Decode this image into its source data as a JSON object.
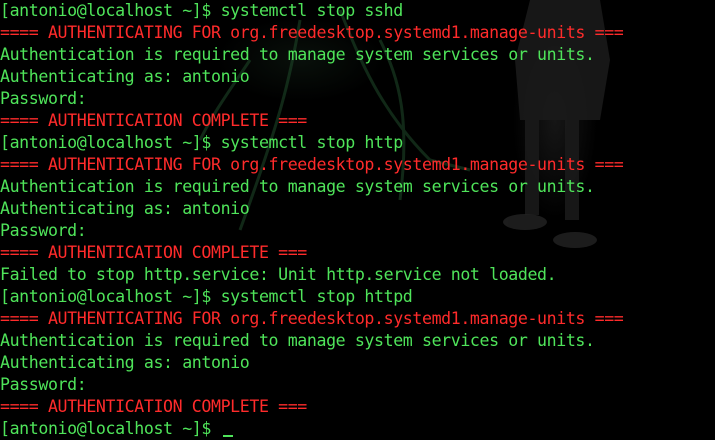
{
  "colors": {
    "background": "#000000",
    "prompt": "#4fe45a",
    "output": "#4fe45a",
    "auth_banner": "#ff2b2b"
  },
  "terminal": {
    "lines": [
      {
        "kind": "prompt",
        "text": "[antonio@localhost ~]$ systemctl stop sshd"
      },
      {
        "kind": "auth",
        "text": "==== AUTHENTICATING FOR org.freedesktop.systemd1.manage-units ==="
      },
      {
        "kind": "output",
        "text": "Authentication is required to manage system services or units."
      },
      {
        "kind": "output",
        "text": "Authenticating as: antonio"
      },
      {
        "kind": "output",
        "text": "Password:"
      },
      {
        "kind": "auth",
        "text": "==== AUTHENTICATION COMPLETE ==="
      },
      {
        "kind": "prompt",
        "text": "[antonio@localhost ~]$ systemctl stop http"
      },
      {
        "kind": "auth",
        "text": "==== AUTHENTICATING FOR org.freedesktop.systemd1.manage-units ==="
      },
      {
        "kind": "output",
        "text": "Authentication is required to manage system services or units."
      },
      {
        "kind": "output",
        "text": "Authenticating as: antonio"
      },
      {
        "kind": "output",
        "text": "Password:"
      },
      {
        "kind": "auth",
        "text": "==== AUTHENTICATION COMPLETE ==="
      },
      {
        "kind": "output",
        "text": "Failed to stop http.service: Unit http.service not loaded."
      },
      {
        "kind": "prompt",
        "text": "[antonio@localhost ~]$ systemctl stop httpd"
      },
      {
        "kind": "auth",
        "text": "==== AUTHENTICATING FOR org.freedesktop.systemd1.manage-units ==="
      },
      {
        "kind": "output",
        "text": "Authentication is required to manage system services or units."
      },
      {
        "kind": "output",
        "text": "Authenticating as: antonio"
      },
      {
        "kind": "output",
        "text": "Password:"
      },
      {
        "kind": "auth",
        "text": "==== AUTHENTICATION COMPLETE ==="
      },
      {
        "kind": "input",
        "text": "[antonio@localhost ~]$ "
      }
    ]
  }
}
